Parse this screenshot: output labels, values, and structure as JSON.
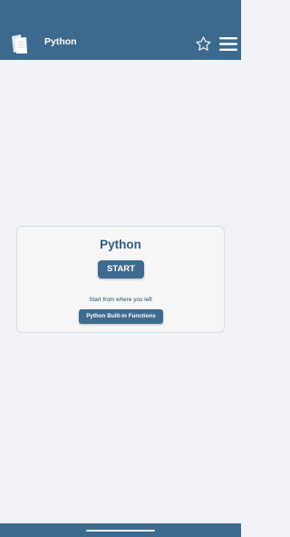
{
  "header": {
    "title": "Python",
    "logo_icon": "app-logo-icon",
    "favorite_icon": "star-icon",
    "menu_icon": "hamburger-menu-icon"
  },
  "card": {
    "title": "Python",
    "start_label": "START",
    "resume_prompt": "Start from where you left",
    "resume_topic": "Python Built-in Functions"
  },
  "colors": {
    "brand": "#3c6a8e",
    "background": "#f1f2f6",
    "title_text": "#2e5d87"
  }
}
